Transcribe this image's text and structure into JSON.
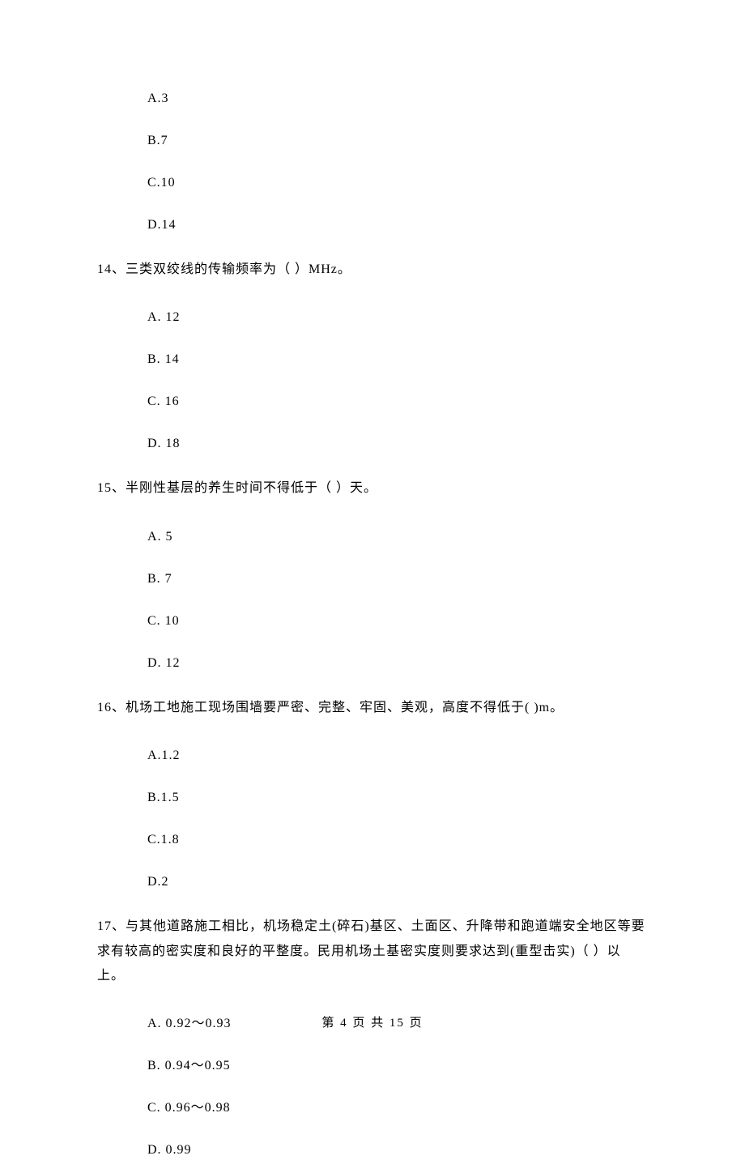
{
  "block1": {
    "opts": [
      "A.3",
      "B.7",
      "C.10",
      "D.14"
    ]
  },
  "q14": {
    "text": "14、三类双绞线的传输频率为（    ）MHz。",
    "opts": [
      "A. 12",
      "B. 14",
      "C. 16",
      "D. 18"
    ]
  },
  "q15": {
    "text": "15、半刚性基层的养生时间不得低于（    ）天。",
    "opts": [
      "A. 5",
      "B. 7",
      "C. 10",
      "D. 12"
    ]
  },
  "q16": {
    "text": "16、机场工地施工现场围墙要严密、完整、牢固、美观，高度不得低于(     )m。",
    "opts": [
      "A.1.2",
      "B.1.5",
      "C.1.8",
      "D.2"
    ]
  },
  "q17": {
    "text": "17、与其他道路施工相比，机场稳定土(碎石)基区、土面区、升降带和跑道端安全地区等要求有较高的密实度和良好的平整度。民用机场土基密实度则要求达到(重型击实)（    ）以上。",
    "opts": [
      "A. 0.92～0.93",
      "B. 0.94～0.95",
      "C. 0.96～0.98",
      "D. 0.99"
    ]
  },
  "footer": "第 4 页 共 15 页"
}
